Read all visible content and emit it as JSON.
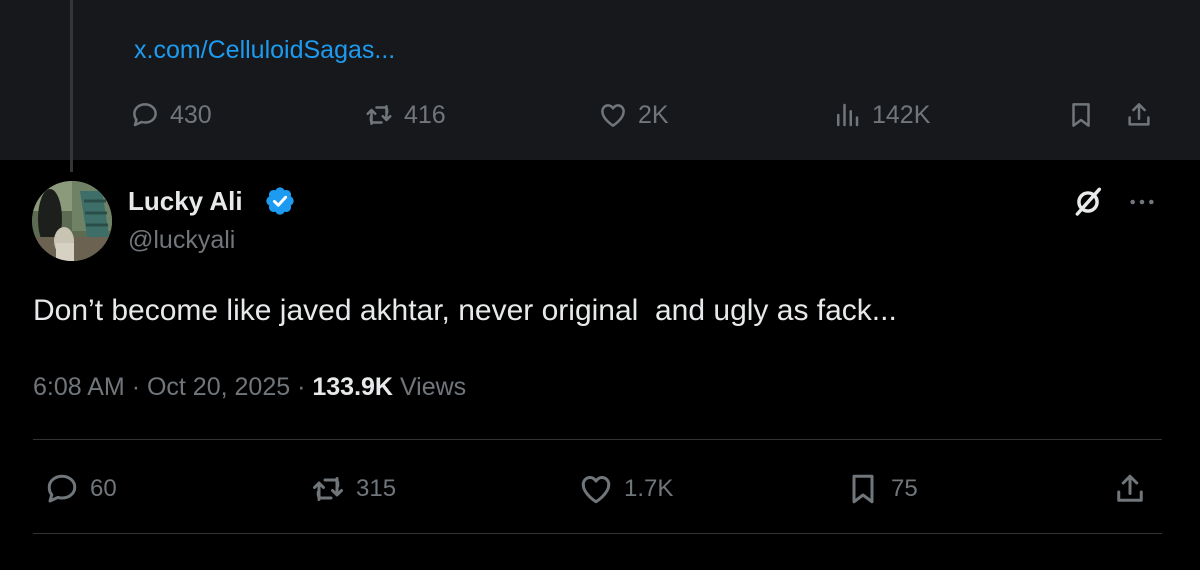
{
  "parent_tweet": {
    "link_text": "x.com/CelluloidSagas...",
    "actions": {
      "replies": "430",
      "reposts": "416",
      "likes": "2K",
      "views": "142K"
    }
  },
  "tweet": {
    "author": {
      "display_name": "Lucky Ali",
      "handle": "@luckyali",
      "verified": true
    },
    "text": "Don’t become like javed akhtar, never original  and ugly as fack...",
    "time": "6:08 AM",
    "date": "Oct 20, 2025",
    "separator": "·",
    "views_count": "133.9K",
    "views_label": "Views",
    "actions": {
      "replies": "60",
      "reposts": "315",
      "likes": "1.7K",
      "bookmarks": "75"
    }
  },
  "colors": {
    "background": "#000000",
    "parent_background": "#16181c",
    "link": "#1d9bf0",
    "verified": "#1d9bf0",
    "text_primary": "#e7e9ea",
    "text_secondary": "#71767b",
    "divider": "#2f3336"
  },
  "icons": [
    "reply-icon",
    "repost-icon",
    "like-icon",
    "views-icon",
    "bookmark-icon",
    "share-icon",
    "verified-icon",
    "grok-icon",
    "more-icon"
  ]
}
